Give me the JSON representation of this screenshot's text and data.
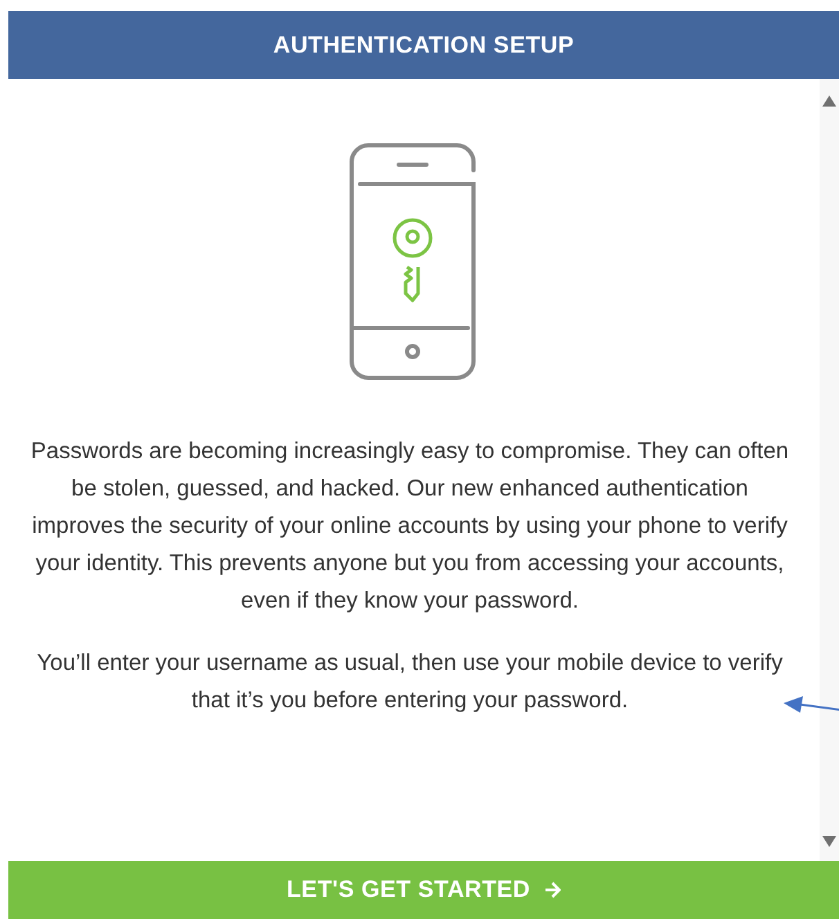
{
  "header": {
    "title": "AUTHENTICATION SETUP"
  },
  "paragraphs": [
    "Passwords are becoming increasingly easy to compromise. They can often be stolen, guessed, and hacked. Our new enhanced authentication improves the security of your online accounts by using your phone to verify your identity. This prevents anyone but you from accessing your accounts, even if they know your password.",
    "You’ll enter your username as usual, then use your mobile device to verify that it’s you before entering your password."
  ],
  "button": {
    "label": "LET'S GET STARTED"
  }
}
